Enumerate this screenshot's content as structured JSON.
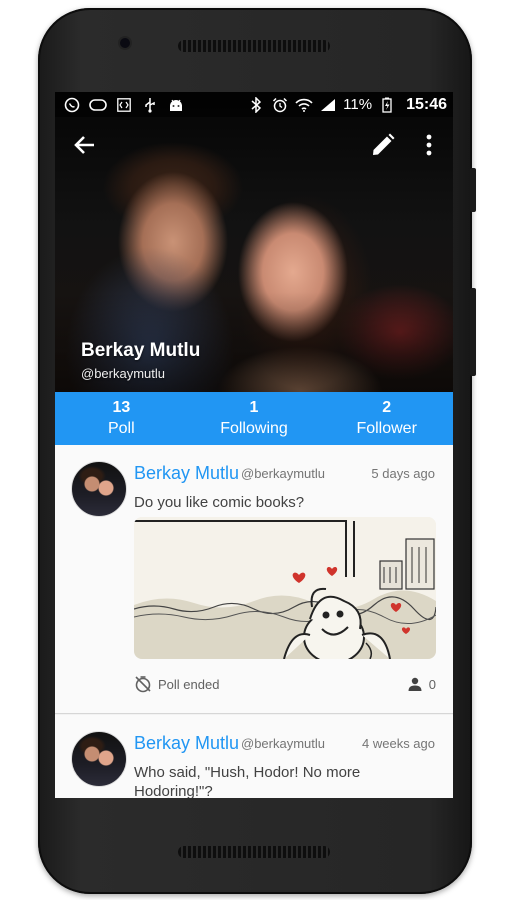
{
  "status_bar": {
    "battery": "11%",
    "time": "15:46",
    "left_icons": [
      "whatsapp-icon",
      "circle-icon",
      "code-icon",
      "usb-icon",
      "android-icon"
    ],
    "right_icons": [
      "bluetooth-icon",
      "alarm-icon",
      "wifi-icon",
      "signal-icon",
      "battery-charging-icon"
    ]
  },
  "toolbar": {
    "back_icon": "arrow-back-icon",
    "edit_icon": "pencil-icon",
    "more_icon": "more-vert-icon"
  },
  "profile": {
    "name": "Berkay Mutlu",
    "handle": "@berkaymutlu"
  },
  "stats": [
    {
      "count": "13",
      "label": "Poll"
    },
    {
      "count": "1",
      "label": "Following"
    },
    {
      "count": "2",
      "label": "Follower"
    }
  ],
  "posts": [
    {
      "author": "Berkay Mutlu",
      "handle": "@berkaymutlu",
      "time": "5 days ago",
      "text": "Do you like comic books?",
      "status": "Poll ended",
      "voters": "0"
    },
    {
      "author": "Berkay Mutlu",
      "handle": "@berkaymutlu",
      "time": "4 weeks ago",
      "text": "Who said, \"Hush, Hodor! No more Hodoring!\"?"
    }
  ],
  "colors": {
    "accent": "#2196f3",
    "feed_bg": "#f2f2f2",
    "card_bg": "#fafafa"
  }
}
